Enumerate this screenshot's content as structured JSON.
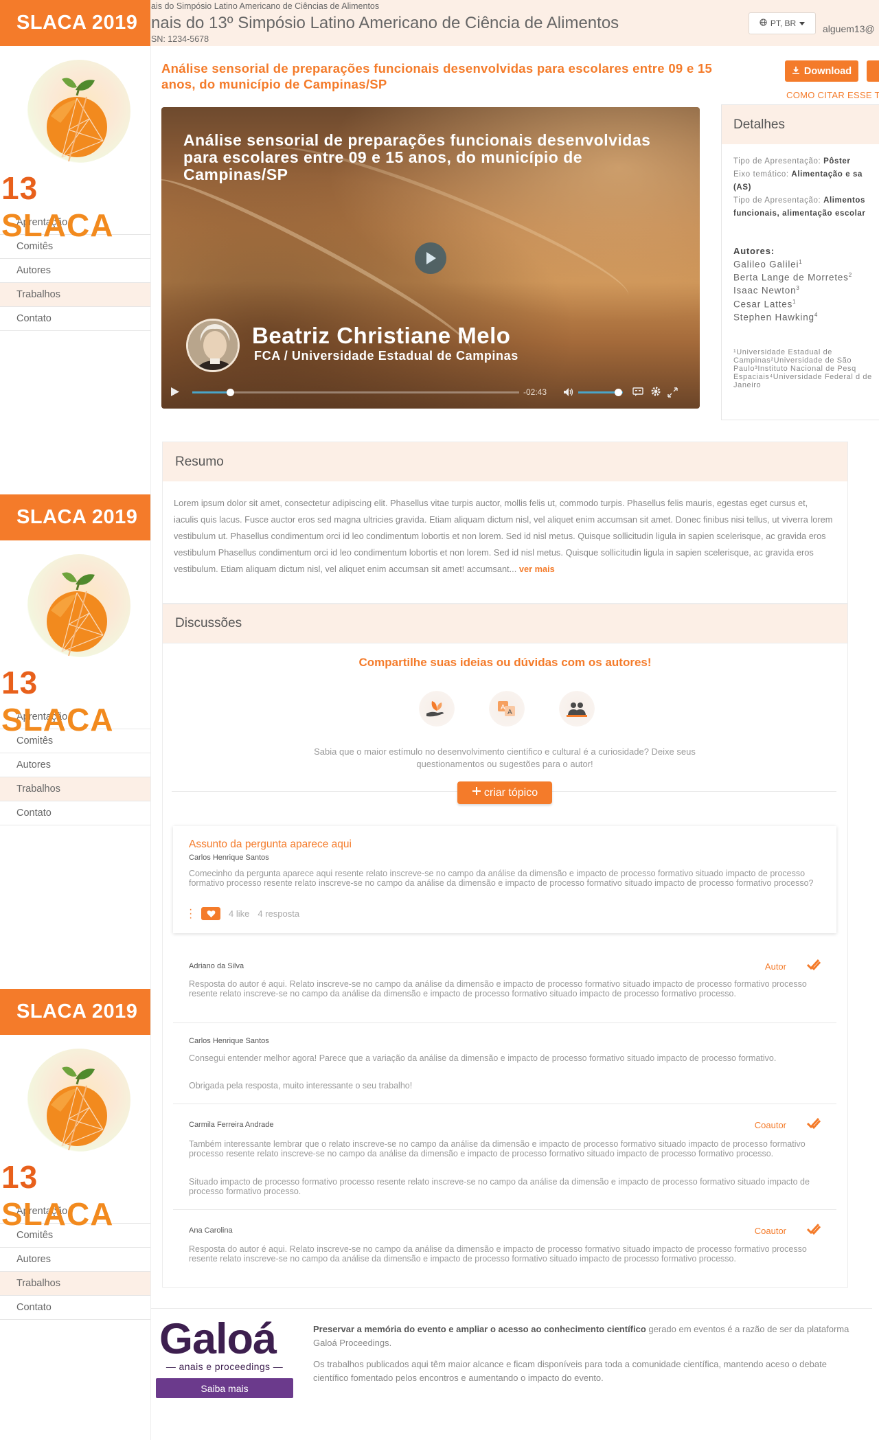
{
  "sidebar": {
    "brand": "SLACA 2019",
    "logo_number": "13",
    "logo_word": "SLACA",
    "menu": [
      {
        "label": "Aprentação",
        "active": false
      },
      {
        "label": "Comitês",
        "active": false
      },
      {
        "label": "Autores",
        "active": false
      },
      {
        "label": "Trabalhos",
        "active": true
      },
      {
        "label": "Contato",
        "active": false
      }
    ]
  },
  "header": {
    "small_title": "ais do Simpósio Latino Americano de Ciências de Alimentos",
    "title": "nais do 13º Simpósio Latino Americano de Ciência de Alimentos",
    "issn": "SN: 1234-5678",
    "language": "PT, BR",
    "user_email": "alguem13@"
  },
  "paper": {
    "title": "Análise sensorial de preparações funcionais desenvolvidas para escolares entre 09 e 15 anos, do município de Campinas/SP",
    "download_label": "Download",
    "cite_label": "COMO CITAR ESSE T"
  },
  "video": {
    "title": "Análise sensorial de preparações funcionais desenvolvidas para escolares entre 09 e 15 anos, do município de Campinas/SP",
    "presenter": "Beatriz Christiane Melo",
    "institution": "FCA / Universidade Estadual de Campinas",
    "time_remaining": "-02:43"
  },
  "details": {
    "heading": "Detalhes",
    "lines": [
      {
        "label": "Tipo de Apresentação:",
        "value": "Pôster"
      },
      {
        "label": "Eixo temático:",
        "value": "Alimentação e sa"
      },
      {
        "label": "",
        "value": "(AS)"
      },
      {
        "label": "Tipo de Apresentação:",
        "value": "Alimentos"
      },
      {
        "label": "",
        "value": "funcionais, alimentação escolar"
      }
    ],
    "authors_label": "Autores:",
    "authors": [
      {
        "name": "Galileo Galilei",
        "sup": "1"
      },
      {
        "name": "Berta Lange de Morretes",
        "sup": "2"
      },
      {
        "name": "Isaac Newton",
        "sup": "3"
      },
      {
        "name": "Cesar Lattes",
        "sup": "1"
      },
      {
        "name": "Stephen Hawking",
        "sup": "4"
      }
    ],
    "affiliations": "¹Universidade Estadual de Campinas²Universidade de São Paulo³Instituto Nacional de Pesq Espaciais⁴Universidade Federal d de Janeiro"
  },
  "resumo": {
    "heading": "Resumo",
    "text": "Lorem ipsum dolor sit amet, consectetur adipiscing elit. Phasellus vitae turpis auctor, mollis felis ut, commodo turpis. Phasellus felis mauris, egestas eget cursus et, iaculis quis lacus. Fusce auctor eros sed magna ultricies gravida. Etiam aliquam dictum nisl, vel aliquet enim accumsan sit amet. Donec finibus nisi tellus, ut viverra lorem vestibulum ut. Phasellus condimentum orci id leo condimentum lobortis et non lorem. Sed id nisl metus. Quisque sollicitudin ligula in sapien scelerisque, ac gravida eros vestibulum Phasellus condimentum orci id leo condimentum lobortis et non lorem. Sed id nisl metus. Quisque sollicitudin ligula in sapien scelerisque, ac gravida eros vestibulum. Etiam aliquam dictum nisl, vel aliquet enim accumsan sit amet! accumsant...",
    "more_label": "ver mais"
  },
  "discussions": {
    "heading": "Discussões",
    "share_title": "Compartilhe suas ideias ou dúvidas com os autores!",
    "curiosity_text": "Sabia que o maior estímulo no desenvolvimento científico e cultural é a curiosidade? Deixe seus questionamentos ou sugestões para o autor!",
    "new_topic_label": "criar tópico",
    "question": {
      "title": "Assunto da pergunta aparece aqui",
      "author": "Carlos Henrique Santos",
      "body": "Comecinho da pergunta aparece aqui resente relato inscreve-se no campo da análise da dimensão e impacto de processo formativo situado impacto de processo formativo processo resente relato inscreve-se no campo da análise da dimensão e impacto de processo formativo situado impacto de processo formativo processo?",
      "likes": "4 like",
      "replies": "4 resposta"
    },
    "replies": [
      {
        "author": "Adriano da Silva",
        "role": "Autor",
        "paragraphs": [
          "Resposta do autor é aqui. Relato inscreve-se no campo da análise da dimensão e impacto de processo formativo situado impacto de processo formativo processo resente relato inscreve-se no campo da análise da dimensão e impacto de processo formativo situado impacto de processo formativo processo."
        ]
      },
      {
        "author": "Carlos Henrique Santos",
        "role": "",
        "paragraphs": [
          "Consegui entender melhor agora! Parece que a variação da análise da dimensão e impacto de processo formativo situado impacto de processo formativo.",
          "Obrigada pela resposta, muito interessante o seu trabalho!"
        ]
      },
      {
        "author": "Carmila Ferreira Andrade",
        "role": "Coautor",
        "paragraphs": [
          "Também interessante lembrar que o relato inscreve-se no campo da análise da dimensão e impacto de processo formativo situado impacto de processo formativo processo resente relato inscreve-se no campo da análise da dimensão e impacto de processo formativo situado impacto de processo formativo processo.",
          "Situado impacto de processo formativo processo resente relato inscreve-se no campo da análise da dimensão e impacto de processo formativo situado impacto de processo formativo processo."
        ]
      },
      {
        "author": "Ana Carolina",
        "role": "Coautor",
        "paragraphs": [
          "Resposta do autor é aqui. Relato inscreve-se no campo da análise da dimensão e impacto de processo formativo situado impacto de processo formativo processo resente relato inscreve-se no campo da análise da dimensão e impacto de processo formativo situado impacto de processo formativo processo."
        ]
      }
    ]
  },
  "footer": {
    "brand": "Galoá",
    "brand_sub": "anais e proceedings",
    "more_label": "Saiba mais",
    "text_bold": "Preservar a memória do evento e ampliar o acesso ao conhecimento científico",
    "text_rest": " gerado em eventos é a razão de ser da plataforma Galoá Proceedings.",
    "text2": "Os trabalhos publicados aqui têm maior alcance e ficam disponíveis para toda a comunidade científica, mantendo aceso o debate científico fomentado pelos encontros e aumentando o impacto do evento."
  },
  "colors": {
    "accent": "#f47b2a",
    "header_bg": "#fcefe6",
    "galoa_purple": "#3d1f4f"
  }
}
